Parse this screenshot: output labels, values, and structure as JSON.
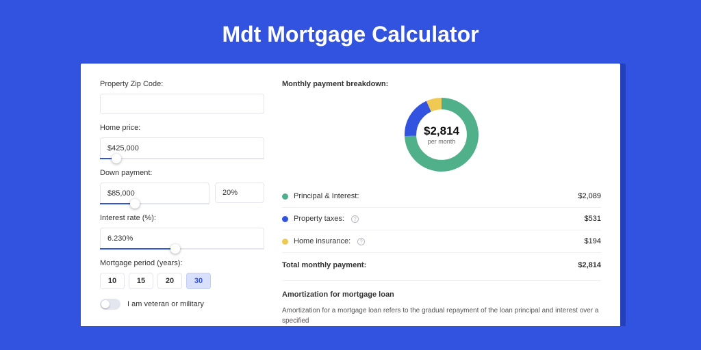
{
  "page": {
    "title": "Mdt Mortgage Calculator"
  },
  "form": {
    "zip": {
      "label": "Property Zip Code:",
      "value": ""
    },
    "home_price": {
      "label": "Home price:",
      "value": "$425,000",
      "slider_pct": 10
    },
    "down_payment": {
      "label": "Down payment:",
      "amount_value": "$85,000",
      "pct_value": "20%",
      "slider_pct": 32
    },
    "interest_rate": {
      "label": "Interest rate (%):",
      "value": "6.230%",
      "slider_pct": 46
    },
    "mortgage_period": {
      "label": "Mortgage period (years):",
      "options": [
        "10",
        "15",
        "20",
        "30"
      ],
      "selected": "30"
    },
    "veteran": {
      "label": "I am veteran or military",
      "value": false
    }
  },
  "breakdown": {
    "title": "Monthly payment breakdown:",
    "center_amount": "$2,814",
    "center_sub": "per month",
    "items": [
      {
        "label": "Principal & Interest:",
        "value": "$2,089",
        "color": "#4fb08a",
        "info": false
      },
      {
        "label": "Property taxes:",
        "value": "$531",
        "color": "#3253e0",
        "info": true
      },
      {
        "label": "Home insurance:",
        "value": "$194",
        "color": "#f0c955",
        "info": true
      }
    ],
    "total": {
      "label": "Total monthly payment:",
      "value": "$2,814"
    }
  },
  "chart_data": {
    "type": "pie",
    "title": "Monthly payment breakdown",
    "series": [
      {
        "name": "Principal & Interest",
        "value": 2089,
        "color": "#4fb08a"
      },
      {
        "name": "Property taxes",
        "value": 531,
        "color": "#3253e0"
      },
      {
        "name": "Home insurance",
        "value": 194,
        "color": "#f0c955"
      }
    ],
    "total": 2814,
    "center_label": "$2,814",
    "center_sub": "per month"
  },
  "amortization": {
    "title": "Amortization for mortgage loan",
    "body": "Amortization for a mortgage loan refers to the gradual repayment of the loan principal and interest over a specified"
  }
}
